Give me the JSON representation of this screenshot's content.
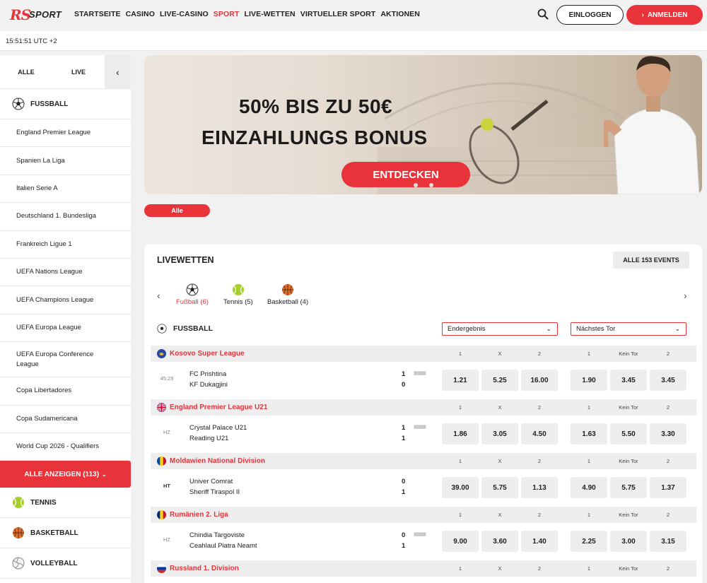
{
  "brand": {
    "rs": "RS",
    "sport": "SPORT"
  },
  "nav": [
    {
      "label": "STARTSEITE",
      "active": false
    },
    {
      "label": "CASINO",
      "active": false
    },
    {
      "label": "LIVE-CASINO",
      "active": false
    },
    {
      "label": "SPORT",
      "active": true
    },
    {
      "label": "LIVE-WETTEN",
      "active": false
    },
    {
      "label": "VIRTUELLER SPORT",
      "active": false
    },
    {
      "label": "AKTIONEN",
      "active": false
    }
  ],
  "header": {
    "login": "EINLOGGEN",
    "register": "ANMELDEN"
  },
  "clock": "15:51:51 UTC +2",
  "sidebar": {
    "tabs": {
      "all": "ALLE",
      "live": "LIVE",
      "collapse": "‹"
    },
    "football": "FUSSBALL",
    "leagues": [
      "England Premier League",
      "Spanien La Liga",
      "Italien Serie A",
      "Deutschland 1. Bundesliga",
      "Frankreich Ligue 1",
      "UEFA Nations League",
      "UEFA Champions League",
      "UEFA Europa League",
      "UEFA Europa Conference League",
      "Copa Libertadores",
      "Copa Sudamericana",
      "World Cup 2026 - Qualifiers"
    ],
    "show_all": "ALLE ANZEIGEN (113)",
    "other_sports": [
      "TENNIS",
      "BASKETBALL",
      "VOLLEYBALL"
    ]
  },
  "banner": {
    "line1": "50% BIS ZU 50€",
    "line2": "EINZAHLUNGS BONUS",
    "cta": "ENTDECKEN"
  },
  "filter_pill": "Alle",
  "live": {
    "title": "LIVEWETTEN",
    "all_events": "ALLE 153 EVENTS",
    "sport_tabs": [
      {
        "label": "Fußball (6)",
        "icon": "football-icon",
        "active": true
      },
      {
        "label": "Tennis (5)",
        "icon": "tennis-icon",
        "active": false
      },
      {
        "label": "Basketball (4)",
        "icon": "basketball-icon",
        "active": false
      }
    ],
    "section": "FUSSBALL",
    "market1": "Endergebnis",
    "market2": "Nächstes Tor",
    "cols1": [
      "1",
      "X",
      "2"
    ],
    "cols2": [
      "1",
      "Kein Tor",
      "2"
    ],
    "leagues": [
      {
        "name": "Kosovo Super League",
        "flag": "kosovo-flag",
        "match": {
          "time": "45:29",
          "home": "FC Prishtina",
          "away": "KF Dukagjini",
          "hs": "1",
          "as": "0",
          "odds": [
            "1.21",
            "5.25",
            "16.00",
            "1.90",
            "3.45",
            "3.45"
          ]
        }
      },
      {
        "name": "England Premier League U21",
        "flag": "uk-flag",
        "match": {
          "time": "HZ",
          "home": "Crystal Palace U21",
          "away": "Reading U21",
          "hs": "1",
          "as": "1",
          "odds": [
            "1.86",
            "3.05",
            "4.50",
            "1.63",
            "5.50",
            "3.30"
          ]
        }
      },
      {
        "name": "Moldawien National Division",
        "flag": "moldova-flag",
        "match": {
          "time": "HT",
          "home": "Univer Comrat",
          "away": "Sheriff Tiraspol II",
          "hs": "0",
          "as": "1",
          "odds": [
            "39.00",
            "5.75",
            "1.13",
            "4.90",
            "5.75",
            "1.37"
          ]
        }
      },
      {
        "name": "Rumänien 2. Liga",
        "flag": "romania-flag",
        "match": {
          "time": "HZ",
          "home": "Chindia Targoviste",
          "away": "Ceahlaul Piatra Neamt",
          "hs": "0",
          "as": "1",
          "odds": [
            "9.00",
            "3.60",
            "1.40",
            "2.25",
            "3.00",
            "3.15"
          ]
        }
      },
      {
        "name": "Russland 1. Division",
        "flag": "russia-flag"
      }
    ]
  },
  "colors": {
    "accent": "#e8333b",
    "bg": "#f1f1f1"
  }
}
